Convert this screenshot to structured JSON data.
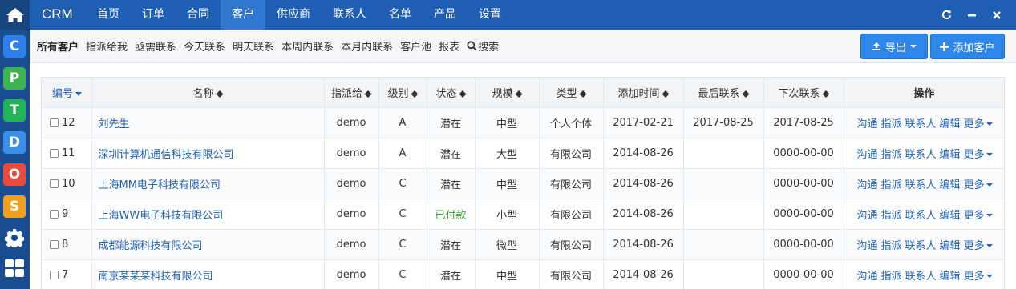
{
  "topbar": {
    "brand": "CRM",
    "nav": [
      "首页",
      "订单",
      "合同",
      "客户",
      "供应商",
      "联系人",
      "名单",
      "产品",
      "设置"
    ],
    "active_index": 3
  },
  "rail": {
    "apps": [
      {
        "letter": "C",
        "color": "#2f80ed",
        "name": "app-c"
      },
      {
        "letter": "P",
        "color": "#3fb34f",
        "name": "app-p"
      },
      {
        "letter": "T",
        "color": "#21b357",
        "name": "app-t"
      },
      {
        "letter": "D",
        "color": "#3b8fe8",
        "name": "app-d"
      },
      {
        "letter": "O",
        "color": "#e84b3c",
        "name": "app-o"
      },
      {
        "letter": "S",
        "color": "#f0a020",
        "name": "app-s"
      }
    ]
  },
  "subbar": {
    "items": [
      "所有客户",
      "指派给我",
      "亟需联系",
      "今天联系",
      "明天联系",
      "本周内联系",
      "本月内联系",
      "客户池",
      "报表"
    ],
    "search_label": "搜索",
    "export_label": "导出",
    "add_label": "添加客户"
  },
  "table": {
    "headers": [
      "编号",
      "名称",
      "指派给",
      "级别",
      "状态",
      "规模",
      "类型",
      "添加时间",
      "最后联系",
      "下次联系",
      "操作"
    ],
    "ops": [
      "沟通",
      "指派",
      "联系人",
      "编辑",
      "更多"
    ],
    "rows": [
      {
        "id": "12",
        "name": "刘先生",
        "assignee": "demo",
        "level": "A",
        "status": "潜在",
        "scale": "中型",
        "type": "个人个体",
        "added": "2017-02-21",
        "last": "2017-08-25",
        "next": "2017-08-25",
        "paid": false
      },
      {
        "id": "11",
        "name": "深圳计算机通信科技有限公司",
        "assignee": "demo",
        "level": "A",
        "status": "潜在",
        "scale": "大型",
        "type": "有限公司",
        "added": "2014-08-26",
        "last": "",
        "next": "0000-00-00",
        "paid": false
      },
      {
        "id": "10",
        "name": "上海MM电子科技有限公司",
        "assignee": "demo",
        "level": "C",
        "status": "潜在",
        "scale": "中型",
        "type": "有限公司",
        "added": "2014-08-26",
        "last": "",
        "next": "0000-00-00",
        "paid": false
      },
      {
        "id": "9",
        "name": "上海WW电子科技有限公司",
        "assignee": "demo",
        "level": "C",
        "status": "已付款",
        "scale": "小型",
        "type": "有限公司",
        "added": "2014-08-26",
        "last": "",
        "next": "0000-00-00",
        "paid": true
      },
      {
        "id": "8",
        "name": "成都能源科技有限公司",
        "assignee": "demo",
        "level": "C",
        "status": "潜在",
        "scale": "微型",
        "type": "有限公司",
        "added": "2014-08-26",
        "last": "",
        "next": "0000-00-00",
        "paid": false
      },
      {
        "id": "7",
        "name": "南京某某某科技有限公司",
        "assignee": "demo",
        "level": "C",
        "status": "潜在",
        "scale": "中型",
        "type": "有限公司",
        "added": "2014-08-26",
        "last": "",
        "next": "0000-00-00",
        "paid": false
      }
    ]
  }
}
